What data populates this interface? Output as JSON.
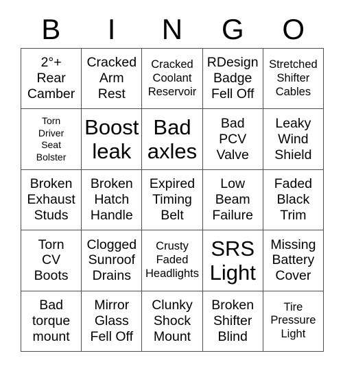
{
  "card": {
    "title_letters": [
      "B",
      "I",
      "N",
      "G",
      "O"
    ],
    "grid_size": "5x5",
    "colors": {
      "border": "#4d4d4d",
      "text": "#000000",
      "background": "#ffffff"
    }
  },
  "grid": {
    "rows": [
      {
        "cells": [
          {
            "text": "2°+\nRear\nCamber",
            "size": "md"
          },
          {
            "text": "Cracked\nArm\nRest",
            "size": "md"
          },
          {
            "text": "Cracked\nCoolant\nReservoir",
            "size": "sm"
          },
          {
            "text": "RDesign\nBadge\nFell Off",
            "size": "md"
          },
          {
            "text": "Stretched\nShifter\nCables",
            "size": "sm"
          }
        ]
      },
      {
        "cells": [
          {
            "text": "Torn\nDriver\nSeat\nBolster",
            "size": "xs"
          },
          {
            "text": "Boost\nleak",
            "size": "xl"
          },
          {
            "text": "Bad\naxles",
            "size": "xl"
          },
          {
            "text": "Bad\nPCV\nValve",
            "size": "md"
          },
          {
            "text": "Leaky\nWind\nShield",
            "size": "md"
          }
        ]
      },
      {
        "cells": [
          {
            "text": "Broken\nExhaust\nStuds",
            "size": "md"
          },
          {
            "text": "Broken\nHatch\nHandle",
            "size": "md"
          },
          {
            "text": "Expired\nTiming\nBelt",
            "size": "md"
          },
          {
            "text": "Low\nBeam\nFailure",
            "size": "md"
          },
          {
            "text": "Faded\nBlack\nTrim",
            "size": "md"
          }
        ]
      },
      {
        "cells": [
          {
            "text": "Torn\nCV\nBoots",
            "size": "md"
          },
          {
            "text": "Clogged\nSunroof\nDrains",
            "size": "md"
          },
          {
            "text": "Crusty\nFaded\nHeadlights",
            "size": "sm"
          },
          {
            "text": "SRS\nLight",
            "size": "xl"
          },
          {
            "text": "Missing\nBattery\nCover",
            "size": "md"
          }
        ]
      },
      {
        "cells": [
          {
            "text": "Bad\ntorque\nmount",
            "size": "md"
          },
          {
            "text": "Mirror\nGlass\nFell Off",
            "size": "md"
          },
          {
            "text": "Clunky\nShock\nMount",
            "size": "md"
          },
          {
            "text": "Broken\nShifter\nBlind",
            "size": "md"
          },
          {
            "text": "Tire\nPressure\nLight",
            "size": "sm"
          }
        ]
      }
    ]
  }
}
